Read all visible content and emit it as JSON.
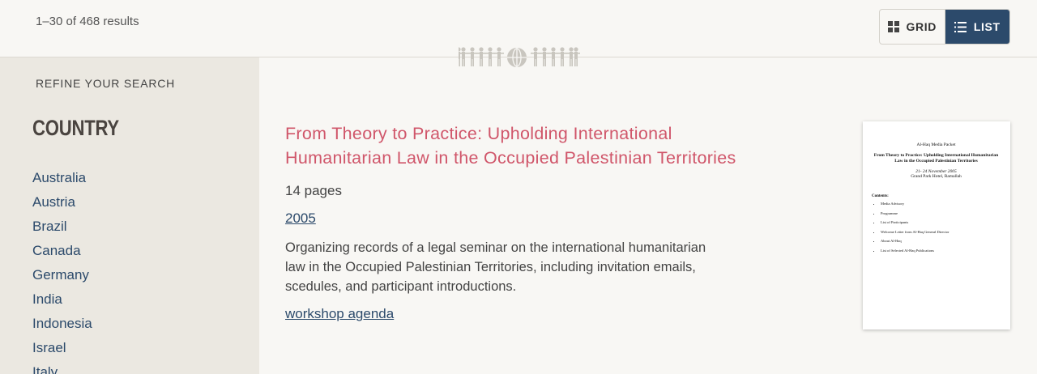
{
  "header": {
    "result_count": "1–30 of 468 results",
    "view_toggle": {
      "grid_label": "GRID",
      "list_label": "LIST",
      "active": "list",
      "active_color": "#2c4a6b"
    }
  },
  "sidebar": {
    "refine_label": "REFINE YOUR SEARCH",
    "facet_title": "COUNTRY",
    "countries": [
      "Australia",
      "Austria",
      "Brazil",
      "Canada",
      "Germany",
      "India",
      "Indonesia",
      "Israel",
      "Italy"
    ]
  },
  "result": {
    "title": "From Theory to Practice: Upholding International Humanitarian Law in the Occupied Palestinian Territories",
    "title_color": "#d0566a",
    "pages": "14 pages",
    "year": "2005",
    "description": "Organizing records of a legal seminar on the international humanitarian law in the Occupied Palestinian Territories, including invitation emails, scedules, and participant introductions.",
    "tag": "workshop agenda"
  },
  "thumbnail": {
    "header": "Al-Haq Media Packet",
    "title": "From Theory to Practice: Upholding International Humanitarian Law in the Occupied Palestinian Territories",
    "date": "21- 24 November 2005",
    "venue": "Grand Park Hotel, Ramallah",
    "contents_label": "Contents:",
    "contents": [
      "Media Advisory",
      "Programme",
      "List of Participants",
      "Welcome Letter from Al-Haq General Director",
      "About Al-Haq",
      "List of Selected Al-Haq Publications"
    ]
  },
  "icons": {
    "grid": "grid-icon",
    "list": "list-icon",
    "decoration": "people-globe-icon"
  }
}
